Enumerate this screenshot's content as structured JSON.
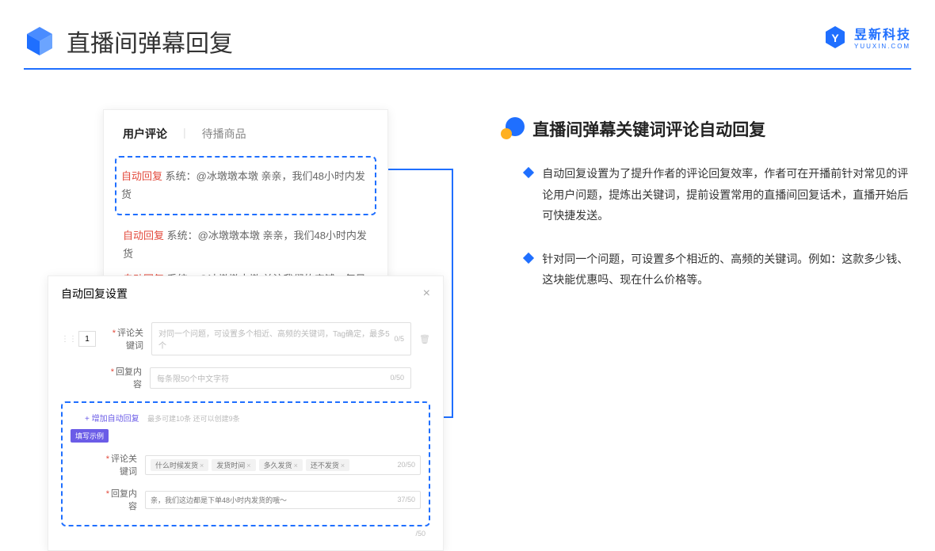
{
  "header": {
    "title": "直播间弹幕回复"
  },
  "brand": {
    "name": "昱新科技",
    "sub": "YUUXIN.COM"
  },
  "comments": {
    "tab_active": "用户评论",
    "tab_other": "待播商品",
    "items": [
      {
        "tag": "自动回复",
        "sys": "系统：",
        "text": "@冰墩墩本墩 亲亲，我们48小时内发货"
      },
      {
        "tag": "自动回复",
        "sys": "系统：",
        "text": "@冰墩墩本墩 亲亲，我们48小时内发货"
      },
      {
        "tag": "自动回复",
        "sys": "系统：",
        "text": "@冰墩墩本墩 关注我们的店铺，每日都有热门推荐呦～"
      }
    ]
  },
  "settings": {
    "title": "自动回复设置",
    "row_num": "1",
    "label_keyword": "评论关键词",
    "ph_keyword": "对同一个问题，可设置多个相近、高频的关键词，Tag确定，最多5个",
    "count_keyword": "0/5",
    "label_content": "回复内容",
    "ph_content": "每条限50个中文字符",
    "count_content": "0/50",
    "add_link": "+ 增加自动回复",
    "add_hint": "最多可建10条 还可以创建9条",
    "example_label": "填写示例",
    "ex_label_keyword": "评论关键词",
    "ex_tags": [
      "什么时候发货",
      "发货时间",
      "多久发货",
      "还不发货"
    ],
    "ex_count_keyword": "20/50",
    "ex_label_content": "回复内容",
    "ex_content": "亲，我们这边都是下单48小时内发货的哦～",
    "ex_count_content": "37/50",
    "outer_count": "/50"
  },
  "right": {
    "title": "直播间弹幕关键词评论自动回复",
    "bullets": [
      "自动回复设置为了提升作者的评论回复效率，作者可在开播前针对常见的评论用户问题，提炼出关键词，提前设置常用的直播间回复话术，直播开始后可快捷发送。",
      "针对同一个问题，可设置多个相近的、高频的关键词。例如：这款多少钱、这块能优惠吗、现在什么价格等。"
    ]
  }
}
